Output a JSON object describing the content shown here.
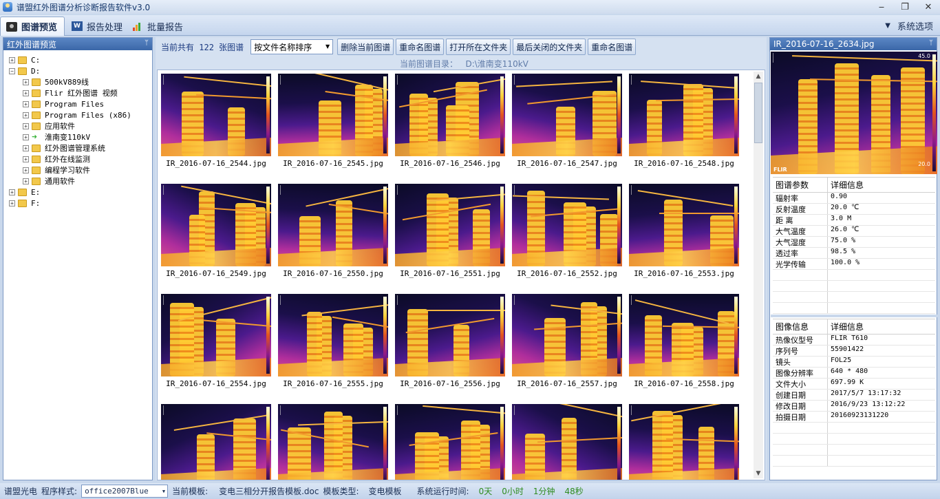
{
  "window": {
    "title": "谱盟红外图谱分析诊断报告软件v3.0",
    "min": "‒",
    "max": "❐",
    "close": "✕"
  },
  "tabs": [
    {
      "label": "图谱预览",
      "icon": "camera-icon"
    },
    {
      "label": "报告处理",
      "icon": "word-doc-icon"
    },
    {
      "label": "批量报告",
      "icon": "bar-chart-icon"
    }
  ],
  "system_options": "系统选项",
  "left_panel": {
    "title": "红外图谱预览",
    "pin": "ᛘ"
  },
  "tree": [
    {
      "label": "C:",
      "level": 0,
      "expander": "+",
      "type": "folder"
    },
    {
      "label": "D:",
      "level": 0,
      "expander": "−",
      "type": "folder"
    },
    {
      "label": "500kV889线",
      "level": 1,
      "expander": "+",
      "type": "folder"
    },
    {
      "label": "Flir 红外图谱  视频",
      "level": 1,
      "expander": "+",
      "type": "folder"
    },
    {
      "label": "Program Files",
      "level": 1,
      "expander": "+",
      "type": "folder"
    },
    {
      "label": "Program Files (x86)",
      "level": 1,
      "expander": "+",
      "type": "folder"
    },
    {
      "label": "应用软件",
      "level": 1,
      "expander": "+",
      "type": "folder"
    },
    {
      "label": "淮南变110kV",
      "level": 1,
      "expander": "+",
      "type": "arrow"
    },
    {
      "label": "红外图谱管理系统",
      "level": 1,
      "expander": "+",
      "type": "folder"
    },
    {
      "label": "红外在线监测",
      "level": 1,
      "expander": "+",
      "type": "folder"
    },
    {
      "label": "编程学习软件",
      "level": 1,
      "expander": "+",
      "type": "folder"
    },
    {
      "label": "通用软件",
      "level": 1,
      "expander": "+",
      "type": "folder"
    },
    {
      "label": "E:",
      "level": 0,
      "expander": "+",
      "type": "folder"
    },
    {
      "label": "F:",
      "level": 0,
      "expander": "+",
      "type": "folder"
    }
  ],
  "toolbar": {
    "count_prefix": "当前共有",
    "count": "122",
    "count_suffix": "张图谱",
    "sort": "按文件名称排序",
    "buttons": [
      "删除当前图谱",
      "重命名图谱",
      "打开所在文件夹",
      "最后关闭的文件夹",
      "重命名图谱"
    ]
  },
  "directory": {
    "label": "当前图谱目录：",
    "path": "D:\\淮南变110kV"
  },
  "thumbnails": [
    "IR_2016-07-16_2544.jpg",
    "IR_2016-07-16_2545.jpg",
    "IR_2016-07-16_2546.jpg",
    "IR_2016-07-16_2547.jpg",
    "IR_2016-07-16_2548.jpg",
    "IR_2016-07-16_2549.jpg",
    "IR_2016-07-16_2550.jpg",
    "IR_2016-07-16_2551.jpg",
    "IR_2016-07-16_2552.jpg",
    "IR_2016-07-16_2553.jpg",
    "IR_2016-07-16_2554.jpg",
    "IR_2016-07-16_2555.jpg",
    "IR_2016-07-16_2556.jpg",
    "IR_2016-07-16_2557.jpg",
    "IR_2016-07-16_2558.jpg",
    "",
    "",
    "",
    "",
    ""
  ],
  "right_panel": {
    "title": "IR_2016-07-16_2634.jpg",
    "pin": "ᛘ",
    "scale_max": "45.0",
    "scale_min": "20.0",
    "brand": "FLIR"
  },
  "params": {
    "header": [
      "图谱参数",
      "详细信息"
    ],
    "rows": [
      [
        "辐射率",
        "0.90"
      ],
      [
        "反射温度",
        "20.0 ℃"
      ],
      [
        "距  离",
        "3.0 M"
      ],
      [
        "大气温度",
        "26.0 ℃"
      ],
      [
        "大气湿度",
        "75.0 %"
      ],
      [
        "透过率",
        "98.5 %"
      ],
      [
        "光学传输",
        "100.0 %"
      ]
    ]
  },
  "image_info": {
    "header": [
      "图像信息",
      "详细信息"
    ],
    "rows": [
      [
        "热像仪型号",
        "FLIR T610"
      ],
      [
        "序列号",
        "55901422"
      ],
      [
        "镜头",
        "FOL25"
      ],
      [
        "图像分辨率",
        "640 * 480"
      ],
      [
        "文件大小",
        "697.99 K"
      ],
      [
        "创建日期",
        "2017/5/7 13:17:32"
      ],
      [
        "修改日期",
        "2016/9/23 13:12:22"
      ],
      [
        "拍摄日期",
        "20160923131220"
      ]
    ]
  },
  "status": {
    "company": "谱盟光电",
    "style_label": "程序样式:",
    "style_value": "office2007Blue",
    "template_label": "当前模板:",
    "template_value": "变电三相分开报告模板.doc",
    "type_label": "模板类型:",
    "type_value": "变电模板",
    "runtime_label": "系统运行时间:",
    "runtime": [
      "0天",
      "0小时",
      "1分钟",
      "48秒"
    ]
  },
  "colors": {
    "accent": "#3b67a8",
    "hot": "#ffcc33",
    "cold": "#0a0a2a",
    "runtime_green": "#2e8b1e"
  }
}
